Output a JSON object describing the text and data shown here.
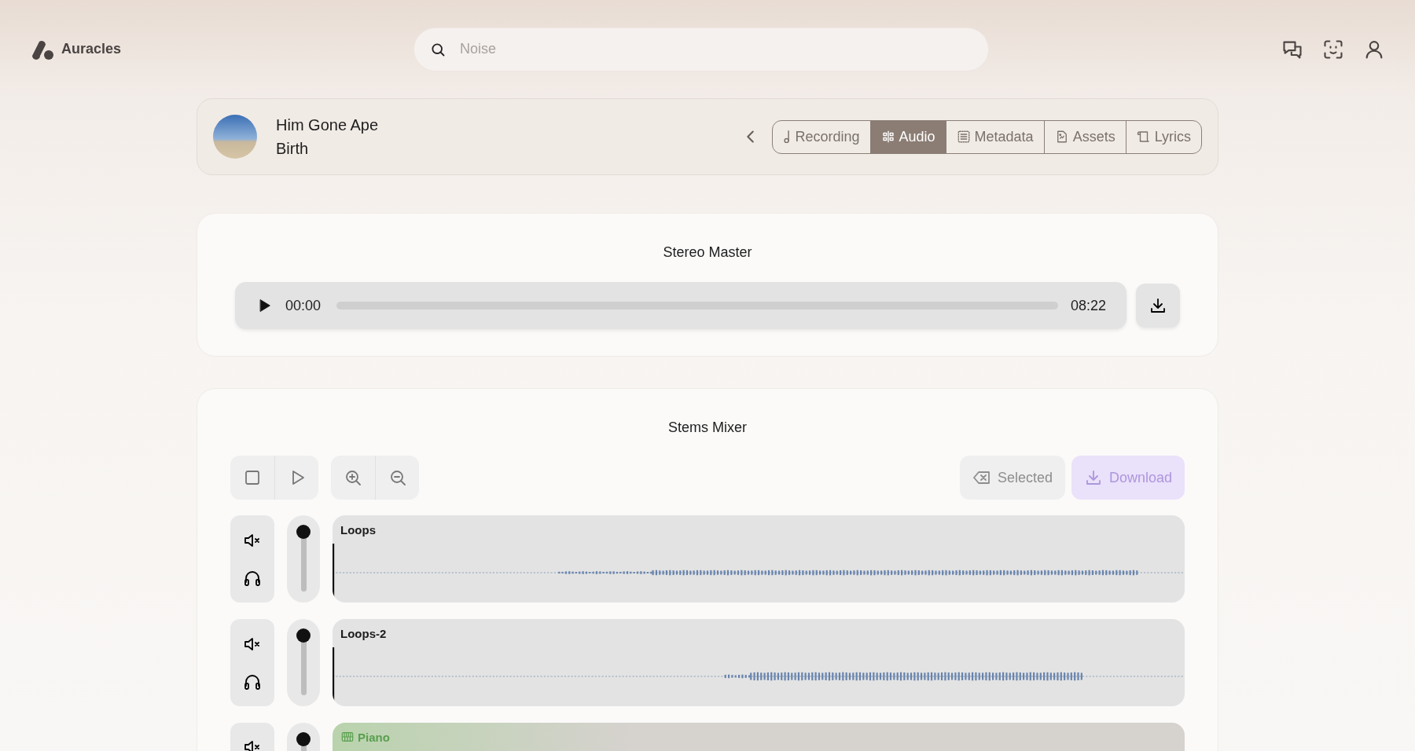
{
  "app": {
    "name": "Auracles"
  },
  "search": {
    "placeholder": "Noise"
  },
  "release": {
    "title": "Him Gone Ape",
    "subtitle": "Birth"
  },
  "tabs": [
    {
      "label": "Recording",
      "selected": false
    },
    {
      "label": "Audio",
      "selected": true
    },
    {
      "label": "Metadata",
      "selected": false
    },
    {
      "label": "Assets",
      "selected": false
    },
    {
      "label": "Lyrics",
      "selected": false
    }
  ],
  "stereo_master": {
    "title": "Stereo Master",
    "current_time": "00:00",
    "duration": "08:22"
  },
  "stems_mixer": {
    "title": "Stems Mixer",
    "actions": [
      {
        "label": "Selected",
        "kind": "clear",
        "disabled": true
      },
      {
        "label": "Download",
        "kind": "download",
        "disabled": true
      }
    ],
    "tracks": [
      {
        "name": "Loops",
        "kind": "audio",
        "level": 1
      },
      {
        "name": "Loops-2",
        "kind": "audio",
        "level": 1
      },
      {
        "name": "Piano",
        "kind": "midi",
        "level": 1
      }
    ]
  }
}
